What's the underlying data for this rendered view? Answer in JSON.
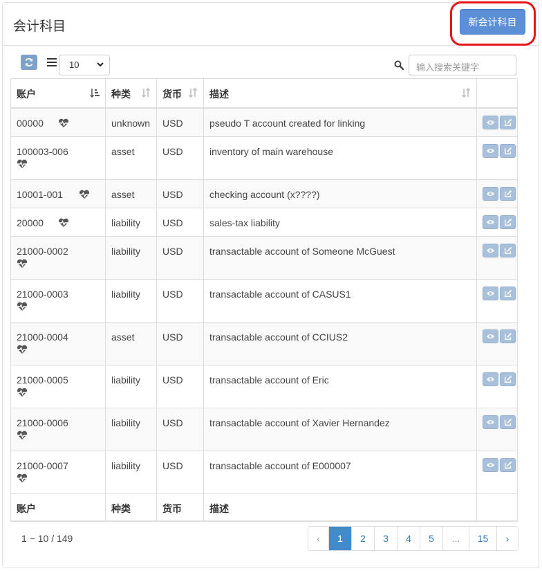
{
  "header": {
    "title": "会计科目",
    "new_button_label": "新会计科目"
  },
  "toolbar": {
    "page_size": "10",
    "search_placeholder": "输入搜索关键字"
  },
  "table": {
    "columns": [
      "账户",
      "种类",
      "货币",
      "描述"
    ],
    "footer_columns": [
      "账户",
      "种类",
      "货币",
      "描述"
    ],
    "rows": [
      {
        "account": "00000",
        "type": "unknown",
        "currency": "USD",
        "description": "pseudo T account created for linking"
      },
      {
        "account": "100003-006",
        "type": "asset",
        "currency": "USD",
        "description": "inventory of main warehouse"
      },
      {
        "account": "10001-001",
        "type": "asset",
        "currency": "USD",
        "description": "checking account (x????)"
      },
      {
        "account": "20000",
        "type": "liability",
        "currency": "USD",
        "description": "sales-tax liability"
      },
      {
        "account": "21000-0002",
        "type": "liability",
        "currency": "USD",
        "description": "transactable account of Someone McGuest"
      },
      {
        "account": "21000-0003",
        "type": "liability",
        "currency": "USD",
        "description": "transactable account of CASUS1"
      },
      {
        "account": "21000-0004",
        "type": "asset",
        "currency": "USD",
        "description": "transactable account of CCIUS2"
      },
      {
        "account": "21000-0005",
        "type": "liability",
        "currency": "USD",
        "description": "transactable account of Eric"
      },
      {
        "account": "21000-0006",
        "type": "liability",
        "currency": "USD",
        "description": "transactable account of Xavier Hernandez"
      },
      {
        "account": "21000-0007",
        "type": "liability",
        "currency": "USD",
        "description": "transactable account of E000007"
      }
    ]
  },
  "pagination": {
    "range_text": "1 ~ 10 / 149",
    "prev": "‹",
    "pages": [
      "1",
      "2",
      "3",
      "4",
      "5",
      "...",
      "15"
    ],
    "next": "›",
    "active_page": "1"
  },
  "icons": {
    "refresh": "refresh-icon",
    "list": "list-icon",
    "search": "search-icon",
    "health": "heartbeat-icon",
    "view": "eye-icon",
    "edit": "edit-icon"
  },
  "colors": {
    "primary_button": "#5b8fd6",
    "highlight_ring": "#e8141a",
    "action_button": "#a9c0db",
    "active_page": "#428bca"
  }
}
